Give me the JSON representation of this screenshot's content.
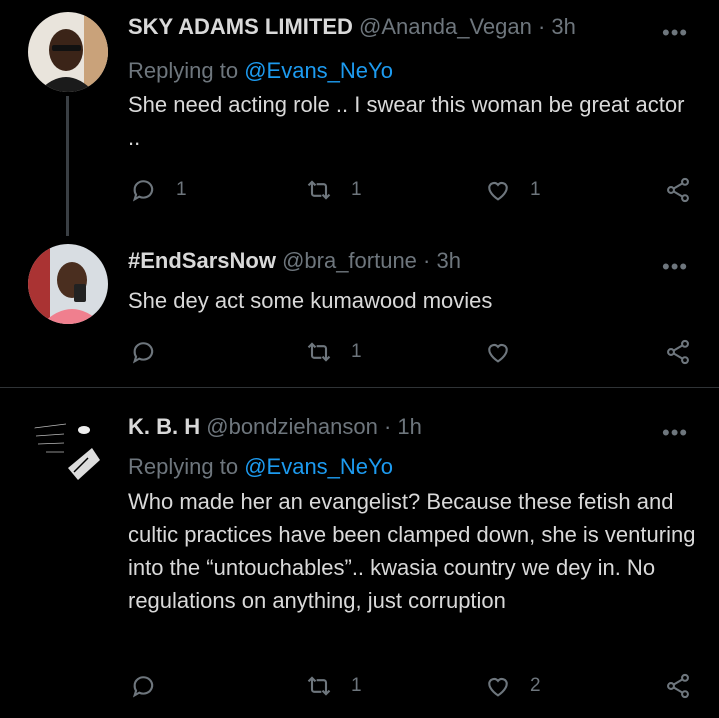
{
  "tweets": [
    {
      "display_name": "SKY ADAMS LIMITED",
      "handle": "@Ananda_Vegan",
      "time": "· 3h",
      "replying_label": "Replying to",
      "replying_to": "@Evans_NeYo",
      "text": "She need acting role .. I swear this woman be great actor ..",
      "reply_count": "1",
      "retweet_count": "1",
      "like_count": "1"
    },
    {
      "display_name": "#EndSarsNow",
      "handle": "@bra_fortune",
      "time": "· 3h",
      "text": "She dey act some kumawood movies",
      "reply_count": "",
      "retweet_count": "1",
      "like_count": ""
    },
    {
      "display_name": "K. B. H",
      "handle": "@bondziehanson",
      "time": "· 1h",
      "replying_label": "Replying to",
      "replying_to": "@Evans_NeYo",
      "text": "Who made her an evangelist? Because these fetish and cultic practices have been clamped down, she is venturing into the “untouchables”.. kwasia country we dey in. No regulations on anything, just corruption",
      "reply_count": "",
      "retweet_count": "1",
      "like_count": "2"
    }
  ],
  "more_icon": "•••",
  "icons": [
    "reply-icon",
    "retweet-icon",
    "like-icon",
    "share-icon"
  ],
  "colors": {
    "background": "#000000",
    "muted": "#6e767d",
    "link": "#1d9bf0",
    "text": "#d9d9d9"
  }
}
